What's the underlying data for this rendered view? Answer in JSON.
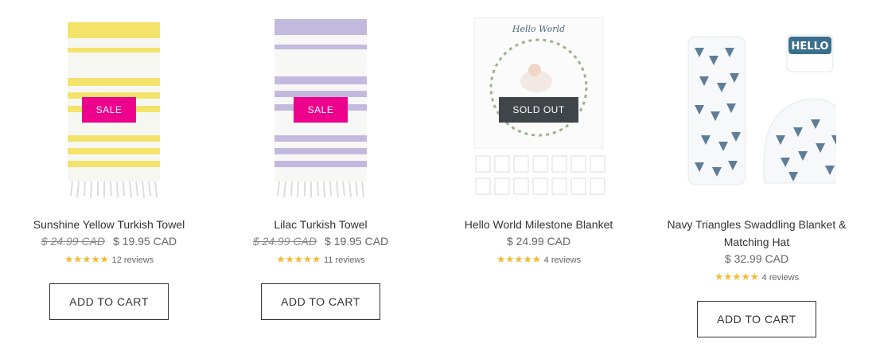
{
  "products": [
    {
      "title": "Sunshine Yellow Turkish Towel",
      "badge": "SALE",
      "price_was": "$ 24.99 CAD",
      "price": "$ 19.95 CAD",
      "reviews": "12 reviews",
      "rating": 5,
      "cta": "ADD TO CART",
      "stripe_color": "#f3e36a"
    },
    {
      "title": "Lilac Turkish Towel",
      "badge": "SALE",
      "price_was": "$ 24.99 CAD",
      "price": "$ 19.95 CAD",
      "reviews": "11 reviews",
      "rating": 5,
      "cta": "ADD TO CART",
      "stripe_color": "#c3b9de"
    },
    {
      "title": "Hello World Milestone Blanket",
      "badge": "SOLD OUT",
      "price": "$ 24.99 CAD",
      "reviews": "4 reviews",
      "rating": 5,
      "image_text": "Hello World"
    },
    {
      "title": "Navy Triangles Swaddling Blanket & Matching Hat",
      "price": "$ 32.99 CAD",
      "reviews": "4 reviews",
      "rating": 5,
      "cta": "ADD TO CART",
      "image_text": "HELLO"
    }
  ],
  "stars": "★★★★★",
  "colors": {
    "sale": "#ec008c",
    "sold_out": "#3f4549",
    "star": "#f3bd3b"
  }
}
